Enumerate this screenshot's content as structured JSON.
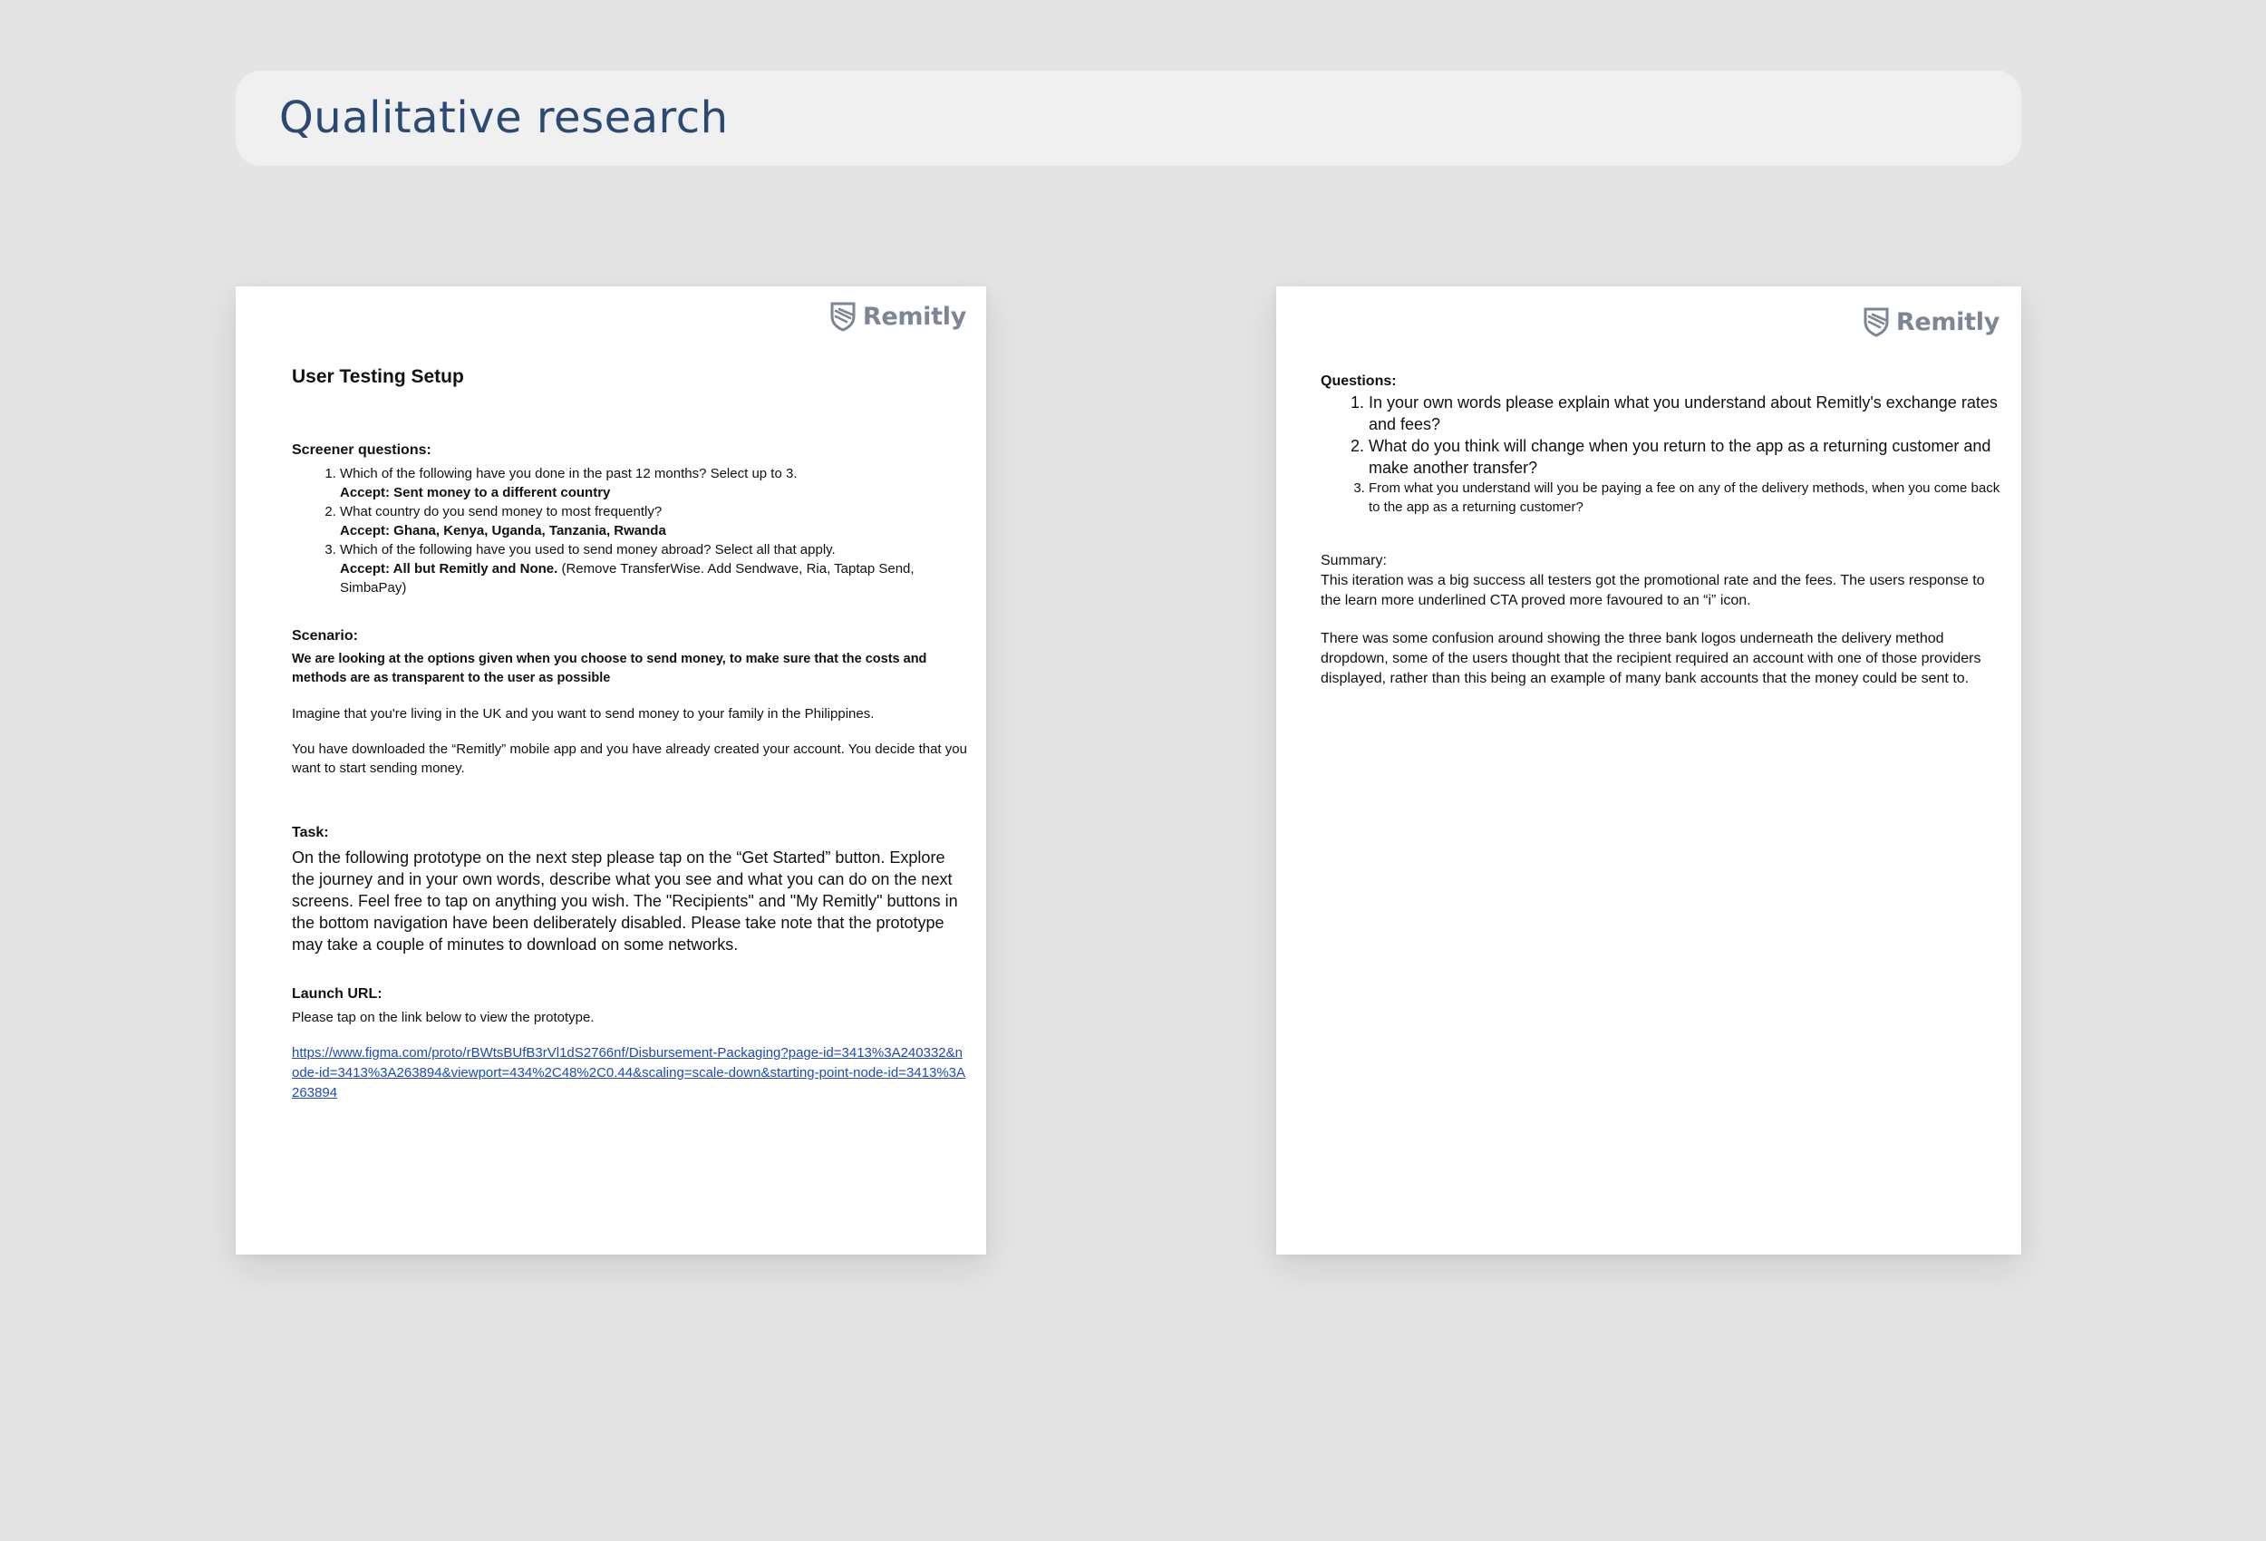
{
  "page": {
    "title": "Qualitative research"
  },
  "brand": {
    "name": "Remitly"
  },
  "left_doc": {
    "title": "User Testing Setup",
    "screener": {
      "heading": "Screener questions:",
      "items": [
        {
          "q": "Which of the following have you done in the past 12 months? Select up to 3.",
          "accept": "Accept: Sent money to a different country",
          "accept_extra": ""
        },
        {
          "q": "What country do you send money to most frequently?",
          "accept": "Accept: Ghana, Kenya, Uganda, Tanzania, Rwanda",
          "accept_extra": ""
        },
        {
          "q": "Which of the following have you used to send money abroad? Select all that apply.",
          "accept": "Accept: All but Remitly and None.",
          "accept_extra": " (Remove TransferWise. Add Sendwave, Ria, Taptap Send, SimbaPay)"
        }
      ]
    },
    "scenario": {
      "heading": "Scenario:",
      "lead": "We are looking at the options given when you choose to send money,  to make sure that the costs and methods are as transparent to the user as possible",
      "p1": "Imagine that you're living in the UK and you want to send money to your family in the Philippines.",
      "p2": "You have downloaded the “Remitly” mobile app and you have already created your account. You decide that you want to start sending money."
    },
    "task": {
      "heading": "Task:",
      "text": "On the following prototype on the next step please tap on the “Get Started” button. Explore the journey and in your own words, describe what you see and what you can do on the next screens. Feel free to tap on anything you wish. The \"Recipients\" and \"My Remitly\" buttons in the bottom navigation have been deliberately disabled. Please take note that the prototype may take a couple of minutes to download on some networks."
    },
    "launch": {
      "heading": "Launch URL:",
      "text": "Please tap on the link below to view the prototype.",
      "url": "https://www.figma.com/proto/rBWtsBUfB3rVl1dS2766nf/Disbursement-Packaging?page-id=3413%3A240332&node-id=3413%3A263894&viewport=434%2C48%2C0.44&scaling=scale-down&starting-point-node-id=3413%3A263894"
    }
  },
  "right_doc": {
    "questions": {
      "heading": "Questions:",
      "items": [
        "In your own words please explain what you understand about Remitly's exchange rates and fees?",
        "What do you think will change when you return to the app as a returning customer and make another transfer?",
        "From what you understand will you be paying a fee on any of the delivery methods, when you come back to the app as a returning customer?"
      ]
    },
    "summary": {
      "heading": "Summary:",
      "p1": "This iteration was a big success all testers got the promotional rate and the fees. The users response to the learn more underlined CTA proved more favoured to an “i” icon.",
      "p2": "There was some confusion around showing the three bank logos underneath the delivery method dropdown, some of the users thought that the recipient required an account with one of those providers displayed, rather than this being an example of many bank accounts that the money could be sent to."
    }
  },
  "colors": {
    "title": "#2a4a73",
    "link": "#1f49b5",
    "logo": "#7e8594"
  },
  "icons": {
    "logo": "remitly-shield-icon"
  }
}
